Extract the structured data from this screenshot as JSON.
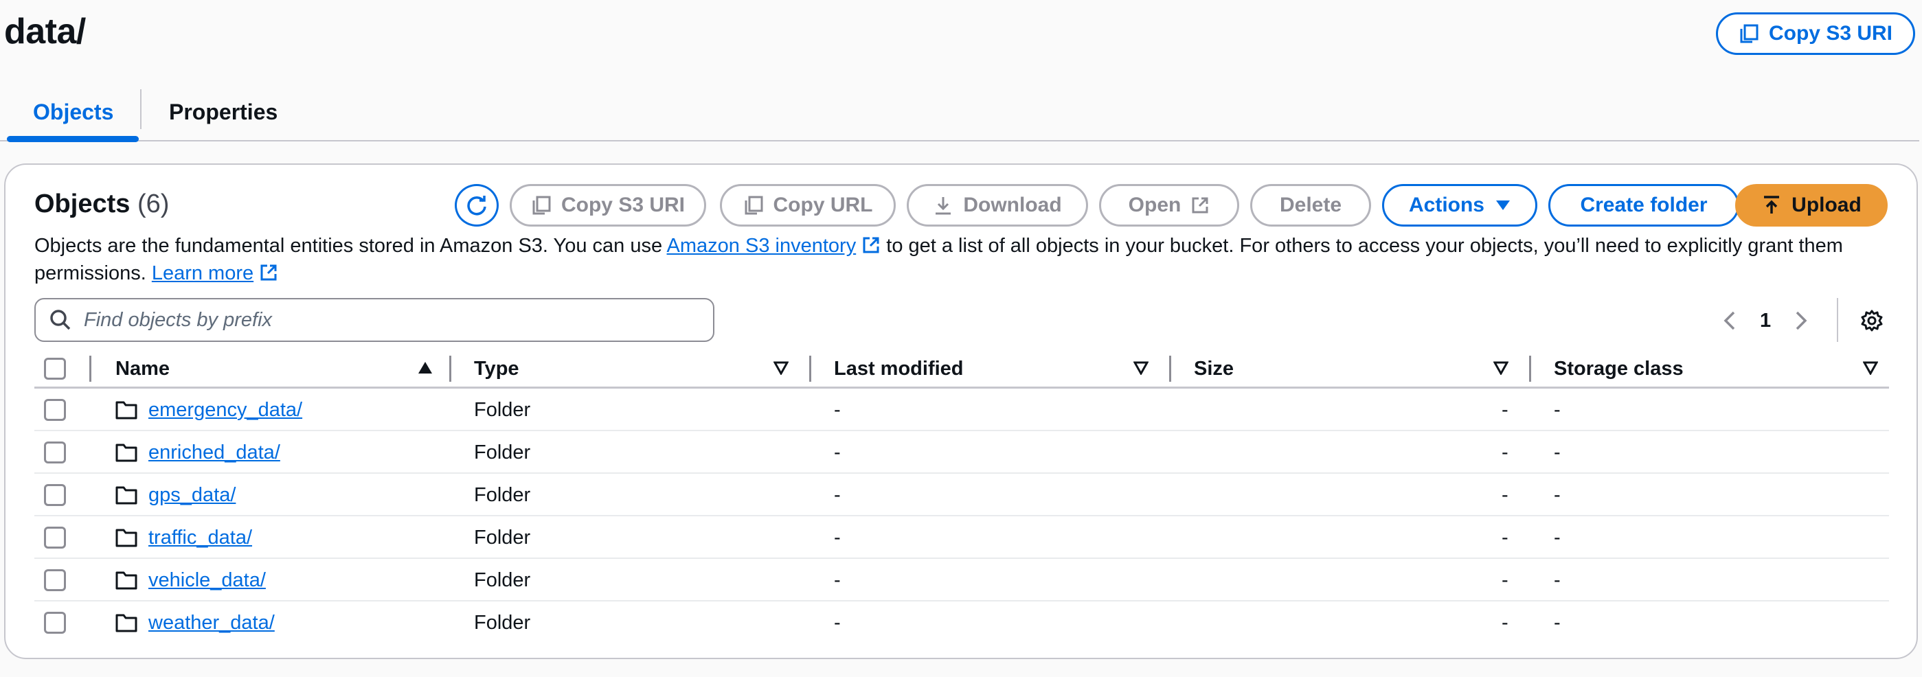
{
  "header": {
    "title": "data/",
    "copy_s3_uri": "Copy S3 URI"
  },
  "tabs": [
    {
      "label": "Objects",
      "active": true
    },
    {
      "label": "Properties",
      "active": false
    }
  ],
  "objects_panel": {
    "title": "Objects",
    "count": "(6)",
    "toolbar": {
      "copy_s3_uri": "Copy S3 URI",
      "copy_url": "Copy URL",
      "download": "Download",
      "open": "Open",
      "delete": "Delete",
      "actions": "Actions",
      "create_folder": "Create folder",
      "upload": "Upload"
    },
    "description": {
      "part1": "Objects are the fundamental entities stored in Amazon S3. You can use ",
      "inventory_link": "Amazon S3 inventory",
      "part2": " to get a list of all objects in your bucket. For others to access your objects, you’ll need to explicitly grant them permissions. ",
      "learn_more": "Learn more"
    },
    "search": {
      "placeholder": "Find objects by prefix"
    },
    "pagination": {
      "page": "1"
    },
    "columns": [
      "Name",
      "Type",
      "Last modified",
      "Size",
      "Storage class"
    ],
    "rows": [
      {
        "name": "emergency_data/",
        "type": "Folder",
        "last_modified": "-",
        "size": "-",
        "storage_class": "-"
      },
      {
        "name": "enriched_data/",
        "type": "Folder",
        "last_modified": "-",
        "size": "-",
        "storage_class": "-"
      },
      {
        "name": "gps_data/",
        "type": "Folder",
        "last_modified": "-",
        "size": "-",
        "storage_class": "-"
      },
      {
        "name": "traffic_data/",
        "type": "Folder",
        "last_modified": "-",
        "size": "-",
        "storage_class": "-"
      },
      {
        "name": "vehicle_data/",
        "type": "Folder",
        "last_modified": "-",
        "size": "-",
        "storage_class": "-"
      },
      {
        "name": "weather_data/",
        "type": "Folder",
        "last_modified": "-",
        "size": "-",
        "storage_class": "-"
      }
    ]
  },
  "colors": {
    "accent": "#006ce0",
    "upload": "#ec9a36",
    "border": "#c6c6cd",
    "disabled": "#8c8c94"
  },
  "icons": [
    "copy-icon",
    "refresh-icon",
    "download-icon",
    "external-link-icon",
    "caret-down-icon",
    "upload-icon",
    "search-icon",
    "chevron-left-icon",
    "chevron-right-icon",
    "gear-icon",
    "sort-ascending-icon",
    "sort-icon",
    "folder-icon"
  ]
}
